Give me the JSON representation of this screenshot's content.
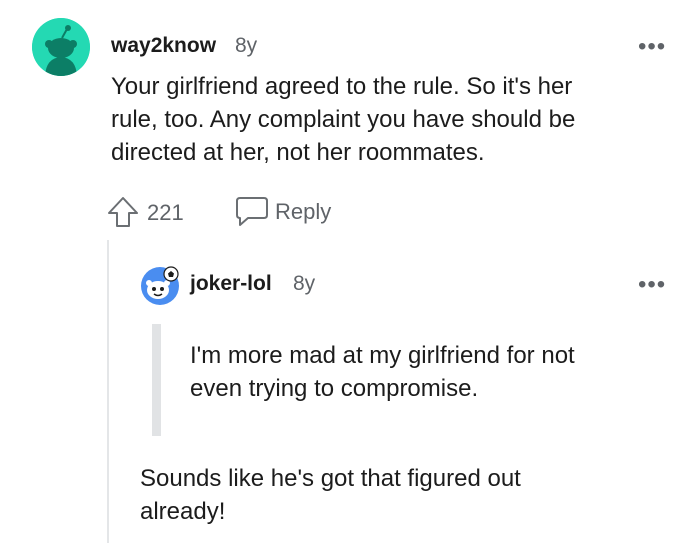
{
  "comment": {
    "username": "way2know",
    "age": "8y",
    "text": "Your girlfriend agreed to the rule. So it's her\nrule, too. Any complaint you have should be\ndirected at her, not her roommates.",
    "upvotes": "221",
    "reply_label": "Reply",
    "more": "•••"
  },
  "reply": {
    "username": "joker-lol",
    "age": "8y",
    "quote": "I'm more mad at my girlfriend for not\neven trying to compromise.",
    "text": "Sounds like he's got that figured out\nalready!",
    "more": "•••"
  },
  "colors": {
    "avatar_main": "#24d9b3",
    "avatar_reply": "#4a8df0",
    "meta_gray": "#5f6368"
  },
  "icons": {
    "upvote": "upvote-arrow-icon",
    "reply": "speech-bubble-icon",
    "more": "more-options-icon"
  }
}
